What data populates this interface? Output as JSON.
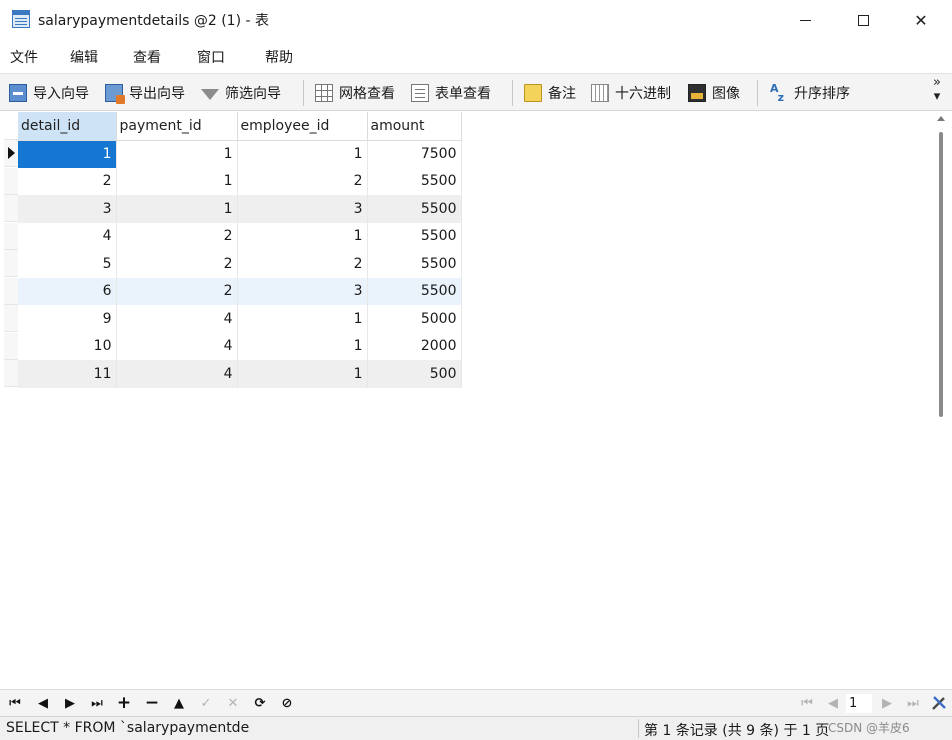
{
  "window": {
    "title": "salarypaymentdetails @2 (1) - 表",
    "controls": {
      "close_glyph": "✕"
    }
  },
  "menu": [
    "文件",
    "编辑",
    "查看",
    "窗口",
    "帮助"
  ],
  "toolbar": {
    "import_label": "导入向导",
    "export_label": "导出向导",
    "filter_label": "筛选向导",
    "grid_view_label": "网格查看",
    "form_view_label": "表单查看",
    "note_label": "备注",
    "hex_label": "十六进制",
    "image_label": "图像",
    "sort_label": "升序排序",
    "more_glyph": "»",
    "dropdown_glyph": "▾"
  },
  "table": {
    "columns": [
      "detail_id",
      "payment_id",
      "employee_id",
      "amount"
    ],
    "rows": [
      [
        "1",
        "1",
        "1",
        "7500"
      ],
      [
        "2",
        "1",
        "2",
        "5500"
      ],
      [
        "3",
        "1",
        "3",
        "5500"
      ],
      [
        "4",
        "2",
        "1",
        "5500"
      ],
      [
        "5",
        "2",
        "2",
        "5500"
      ],
      [
        "6",
        "2",
        "3",
        "5500"
      ],
      [
        "9",
        "4",
        "1",
        "5000"
      ],
      [
        "10",
        "4",
        "1",
        "2000"
      ],
      [
        "11",
        "4",
        "1",
        "500"
      ]
    ],
    "selected_row": 0,
    "selected_column": "detail_id"
  },
  "navigation": {
    "first": "⏮",
    "prev": "◀",
    "next": "▶",
    "last": "⏭",
    "add": "+",
    "delete": "−",
    "apply": "▲",
    "undo": "✓",
    "discard": "✕",
    "refresh": "⟳",
    "stop": "⊘",
    "page_value": "1"
  },
  "status": {
    "sql": "SELECT * FROM `salarypaymentde",
    "records": "第 1 条记录 (共 9 条) 于 1 页",
    "watermark": "CSDN @羊皮6"
  },
  "colors": {
    "selection": "#1677d2",
    "selected_header": "#cfe3f7",
    "alt_row": "#efefef"
  }
}
